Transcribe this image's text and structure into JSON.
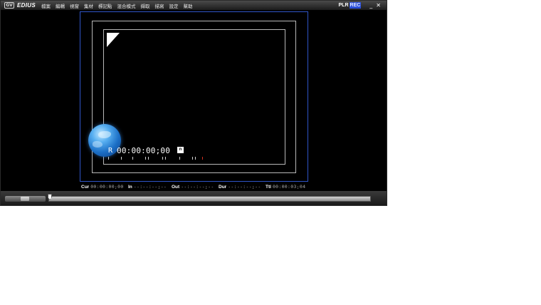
{
  "app": {
    "logo_text": "GV",
    "name": "EDIUS"
  },
  "menu": [
    "檔案",
    "編輯",
    "視窗",
    "集材",
    "標記點",
    "混合模式",
    "擷取",
    "描寫",
    "設定",
    "幫助"
  ],
  "mode": {
    "player_label": "PLR",
    "recorder_label": "REC",
    "active": "REC"
  },
  "window_controls": {
    "minimize": "_",
    "close": "✕"
  },
  "preview": {
    "timecode_prefix": "R",
    "timecode": "00:00:00;00",
    "badge": "n"
  },
  "status": {
    "cur_label": "Cur",
    "cur_value": "00:00:00;00",
    "in_label": "In",
    "in_value": "--:--:--;--",
    "out_label": "Out",
    "out_value": "--:--:--;--",
    "dur_label": "Dur",
    "dur_value": "--:--:--;--",
    "ttl_label": "Ttl",
    "ttl_value": "00:00:03;04"
  },
  "colors": {
    "rec_active": "#2a4ed8",
    "viewport_border": "#2f55c8",
    "safe_area": "#b8b8b8"
  },
  "playhead_position": 0
}
